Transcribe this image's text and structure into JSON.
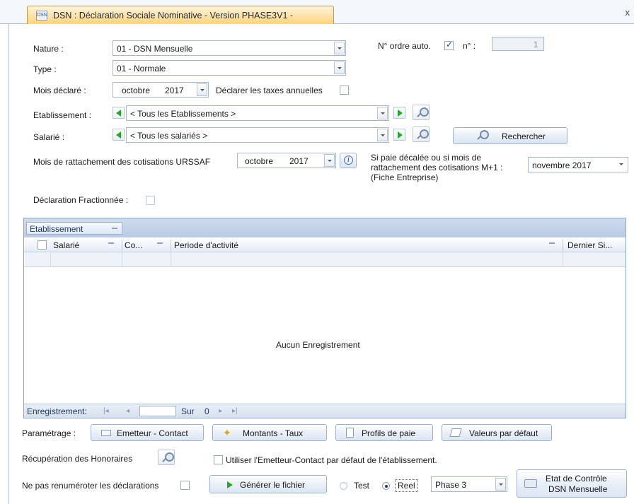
{
  "window": {
    "tab_icon_text": "DSN",
    "tab_title": "DSN : Déclaration Sociale Nominative - Version PHASE3V1 -",
    "close": "x"
  },
  "form": {
    "nature_label": "Nature :",
    "nature_value": "01 - DSN Mensuelle",
    "type_label": "Type :",
    "type_value": "01 - Normale",
    "ordre_label": "N° ordre auto.",
    "ordre_checked": true,
    "num_label": "n° :",
    "num_value": "1",
    "mois_label": "Mois déclaré :",
    "mois_month": "octobre",
    "mois_year": "2017",
    "taxes_label": "Déclarer les taxes annuelles",
    "etab_label": "Etablissement :",
    "etab_value": "< Tous les Etablissements >",
    "salarie_label": "Salarié :",
    "salarie_value": "< Tous les salariés >",
    "rechercher": "Rechercher",
    "rattach_label": "Mois de rattachement des cotisations URSSAF",
    "rattach_month": "octobre",
    "rattach_year": "2017",
    "decalee_line1": "Si paie décalée ou si mois de",
    "decalee_line2": "rattachement des cotisations M+1 :",
    "decalee_line3": "(Fiche Entreprise)",
    "decalee_value": "novembre  2017",
    "fractionnee_label": "Déclaration Fractionnée :"
  },
  "grid": {
    "group_column": "Etablissement",
    "columns": [
      "Salarié",
      "Co...",
      "Periode d'activité",
      "Dernier Si..."
    ],
    "empty_text": "Aucun Enregistrement",
    "footer_label": "Enregistrement:",
    "footer_of": "Sur",
    "footer_count": "0"
  },
  "bottom": {
    "parametrage_label": "Paramétrage :",
    "emetteur_btn": "Emetteur - Contact",
    "montants_btn": "Montants - Taux",
    "profils_btn": "Profils de paie",
    "valeurs_btn": "Valeurs par défaut",
    "honoraires_label": "Récupération des Honoraires",
    "utiliser_label": "Utiliser l'Emetteur-Contact par défaut de l'établissement.",
    "renumeroter_label": "Ne pas renuméroter les déclarations",
    "generer_btn": "Générer le fichier",
    "test_label": "Test",
    "reel_label": "Reel",
    "phase_value": "Phase 3",
    "etat_line1": "Etat de Contrôle",
    "etat_line2": "DSN Mensuelle"
  },
  "colors": {
    "accent": "#ffd27a",
    "grid_header": "#b9cbe4",
    "play_green": "#2aa52a"
  }
}
